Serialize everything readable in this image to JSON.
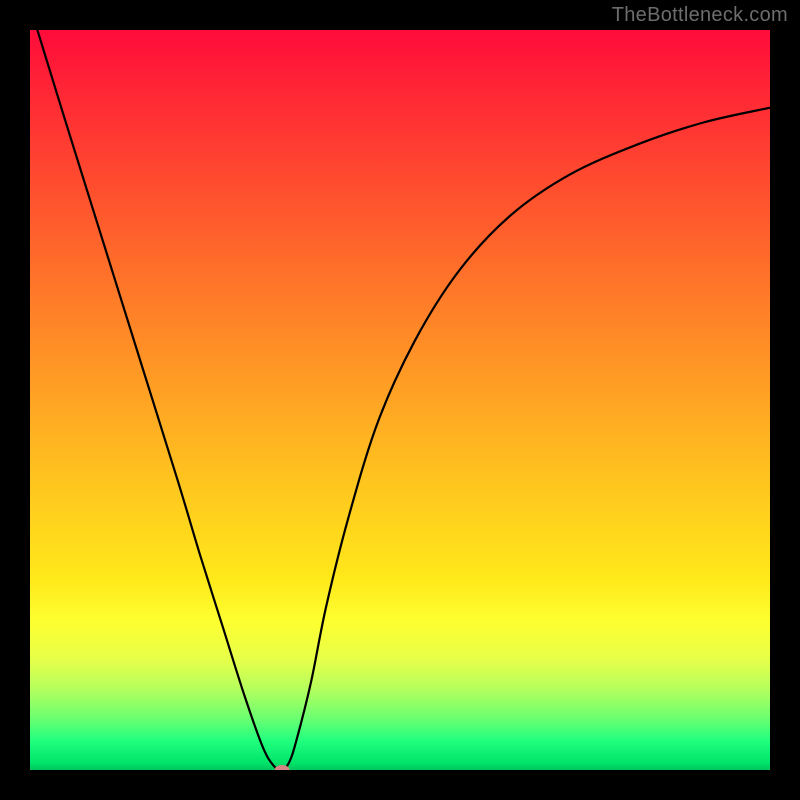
{
  "watermark": "TheBottleneck.com",
  "chart_data": {
    "type": "line",
    "title": "",
    "xlabel": "",
    "ylabel": "",
    "xlim": [
      0,
      100
    ],
    "ylim": [
      0,
      100
    ],
    "series": [
      {
        "name": "curve",
        "x": [
          1,
          5,
          10,
          15,
          20,
          23,
          26,
          29,
          31.5,
          33,
          34,
          35,
          36,
          38,
          40,
          43,
          47,
          52,
          58,
          65,
          73,
          82,
          91,
          100
        ],
        "y": [
          100,
          87,
          71,
          55,
          39,
          29,
          19.5,
          10,
          3,
          0.5,
          0,
          1,
          4,
          12,
          22,
          34,
          47,
          58,
          67.5,
          75,
          80.5,
          84.5,
          87.5,
          89.5
        ]
      }
    ],
    "marker": {
      "x": 34,
      "y": 0,
      "color": "#d58585"
    },
    "gradient_stops": [
      {
        "pct": 0,
        "color": "#ff0b3a"
      },
      {
        "pct": 18,
        "color": "#ff4430"
      },
      {
        "pct": 46,
        "color": "#ff9825"
      },
      {
        "pct": 74,
        "color": "#ffe81a"
      },
      {
        "pct": 89,
        "color": "#b6ff5d"
      },
      {
        "pct": 100,
        "color": "#00c65d"
      }
    ]
  }
}
